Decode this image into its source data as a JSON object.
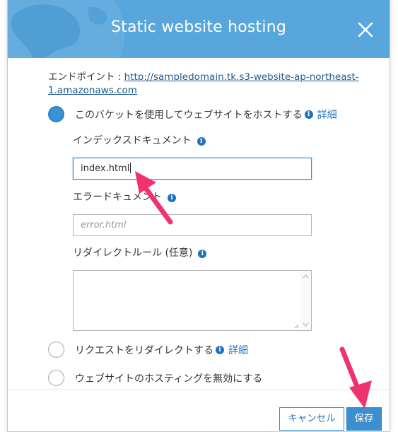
{
  "dialog": {
    "title": "Static website hosting",
    "endpoint_label": "エンドポイント : ",
    "endpoint_url": "http://sampledomain.tk.s3-website-ap-northeast-1.amazonaws.com",
    "options": [
      {
        "label": "このバケットを使用してウェブサイトをホストする",
        "selected": true,
        "detail": "詳細"
      },
      {
        "label": "リクエストをリダイレクトする",
        "selected": false,
        "detail": "詳細"
      },
      {
        "label": "ウェブサイトのホスティングを無効にする",
        "selected": false
      }
    ],
    "index_document": {
      "label": "インデックスドキュメント",
      "value": "index.html"
    },
    "error_document": {
      "label": "エラードキュメント",
      "value": "",
      "placeholder": "error.html"
    },
    "redirect_rules": {
      "label": "リダイレクトルール (任意)",
      "value": ""
    },
    "buttons": {
      "cancel": "キャンセル",
      "save": "保存"
    }
  },
  "colors": {
    "header": "#59a6dc",
    "primary": "#3d8fd2",
    "link": "#1f5a8e",
    "annotation_arrow": "#f0336e"
  },
  "icons": [
    "globe-icon",
    "close-icon",
    "info-icon"
  ]
}
